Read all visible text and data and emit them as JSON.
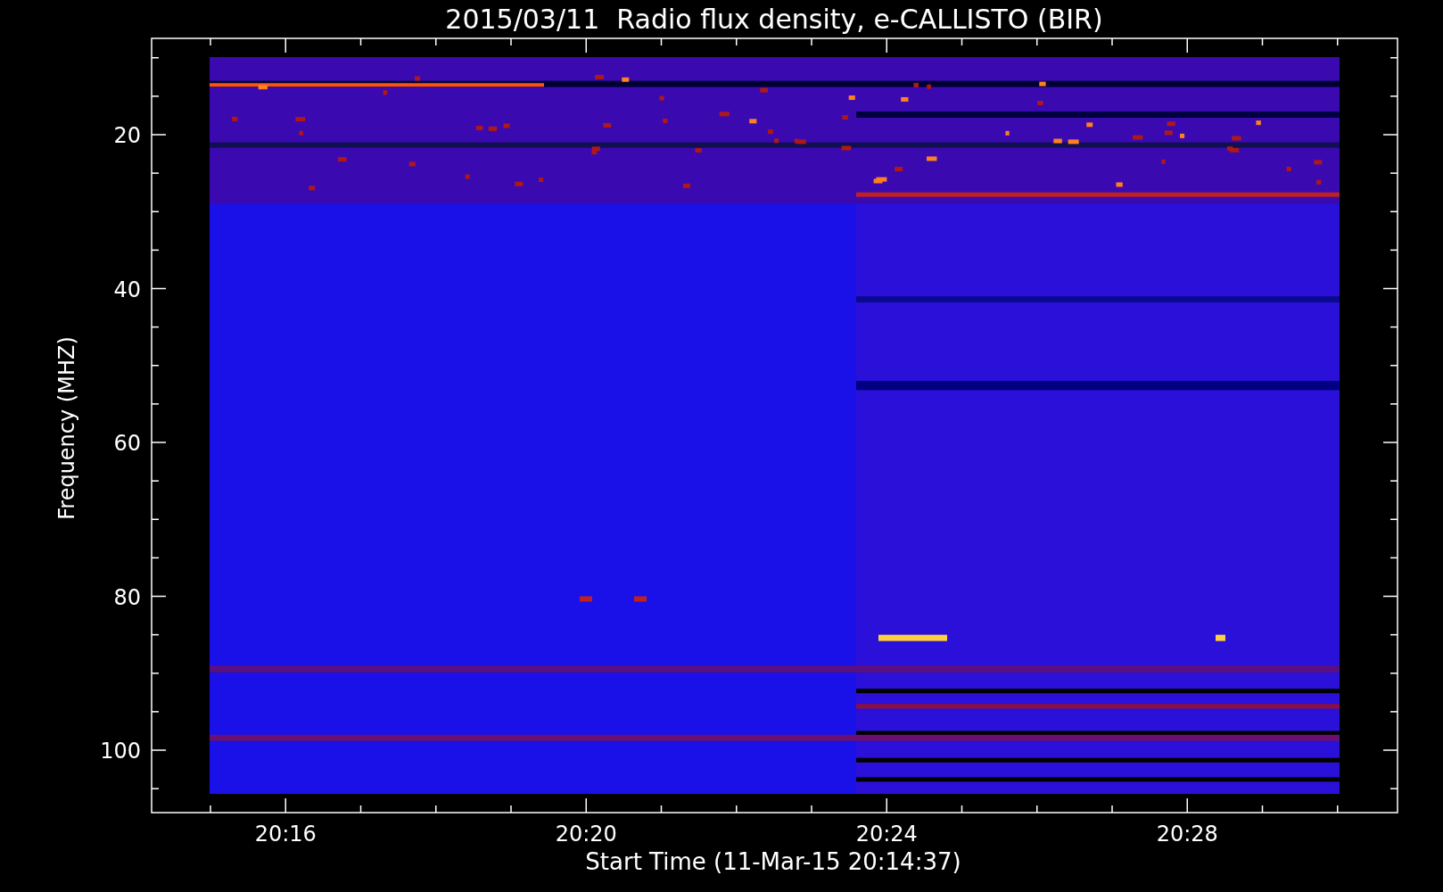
{
  "title": "2015/03/11  Radio flux density, e-CALLISTO (BIR)",
  "y_axis": {
    "label": "Frequency (MHZ)",
    "ticks": [
      "20",
      "40",
      "60",
      "80",
      "100"
    ]
  },
  "x_axis": {
    "label": "Start Time (11-Mar-15 20:14:37)",
    "ticks": [
      "20:16",
      "20:20",
      "20:24",
      "20:28"
    ]
  }
}
